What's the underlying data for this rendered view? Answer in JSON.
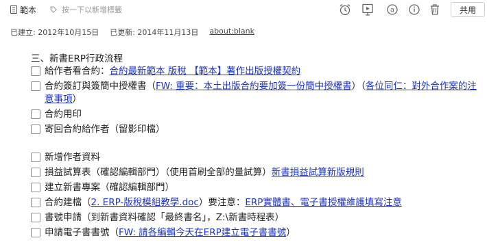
{
  "toolbar": {
    "notebook_name": "範本",
    "tag_placeholder": "按一下以新增標籤",
    "share_label": "共用"
  },
  "meta": {
    "created": "已建立: 2012年10月15日",
    "updated": "已更新: 2014年11月13日",
    "source_url": "about:blank"
  },
  "note": {
    "heading": "三、新書ERP行政流程",
    "group1": [
      {
        "segments": [
          {
            "text": "給作者看合約："
          },
          {
            "text": "合約最新範本 版稅 【範本】著作出版授權契約",
            "link": true
          }
        ]
      },
      {
        "segments": [
          {
            "text": "合約簽訂與簽簡中授權書（"
          },
          {
            "text": "FW: 重要：本土出版合約要加簽一份簡中授權書",
            "link": true
          },
          {
            "text": "）（"
          },
          {
            "text": "各位同仁：對外合作案的注意事項",
            "link": true
          },
          {
            "text": "）"
          }
        ]
      },
      {
        "segments": [
          {
            "text": "合約用印"
          }
        ]
      },
      {
        "segments": [
          {
            "text": "寄回合約給作者（留影印檔）"
          }
        ]
      }
    ],
    "group2": [
      {
        "segments": [
          {
            "text": "新增作者資料"
          }
        ]
      },
      {
        "segments": [
          {
            "text": "損益試算表（確認編輯部門）（使用首刷全部的量試算）"
          },
          {
            "text": "新書損益試算新版規則",
            "link": true
          }
        ]
      },
      {
        "segments": [
          {
            "text": "建立新書專案（確認編輯部門）"
          }
        ]
      },
      {
        "segments": [
          {
            "text": "合約建檔（"
          },
          {
            "text": "2. ERP-版稅模組教學.doc",
            "link": true
          },
          {
            "text": "）要注意："
          },
          {
            "text": "ERP實體書、電子書授權維護填寫注意",
            "link": true
          }
        ]
      },
      {
        "segments": [
          {
            "text": "書號申請（到新書資料確認「最終書名」，Z:\\新書時程表）"
          }
        ]
      },
      {
        "segments": [
          {
            "text": "申請電子書書號（"
          },
          {
            "text": "FW: 請各編輯今天在ERP建立電子書書號",
            "link": true
          },
          {
            "text": "）"
          }
        ]
      }
    ]
  }
}
